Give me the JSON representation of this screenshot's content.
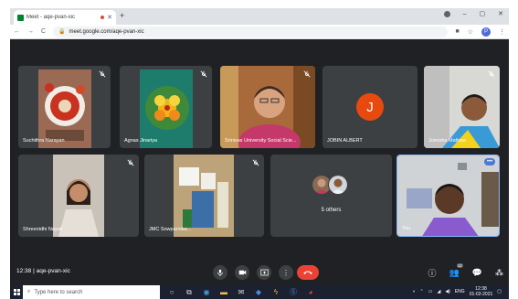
{
  "browser": {
    "tab_title": "Meet - aqe-pvan-xic",
    "tab_close": "✕",
    "new_tab": "+",
    "minimize": "–",
    "maximize": "▢",
    "close": "✕",
    "url": "meet.google.com/aqe-pvan-xic",
    "profile_initial": "P"
  },
  "participants": [
    {
      "name": "Suchithra Narayan",
      "muted": true
    },
    {
      "name": "Agnas Jinariya",
      "muted": true
    },
    {
      "name": "Srinivas University Social Scie...",
      "muted": true
    },
    {
      "name": "JOBIN ALBERT",
      "initial": "J",
      "muted": false
    },
    {
      "name": "Jomisha Mathew",
      "muted": true
    },
    {
      "name": "Shreenidhi Nayak",
      "muted": true
    },
    {
      "name": "JMC Sowparnika...",
      "muted": true
    },
    {
      "name": "5 others",
      "muted": false
    },
    {
      "name": "You",
      "muted": false
    }
  ],
  "meet_toolbar": {
    "time": "12:38",
    "meeting_code": "aqe-pvan-xic",
    "people_count": "12"
  },
  "taskbar": {
    "search_placeholder": "Type here to search",
    "tray_lang": "ENG",
    "clock_time": "12:38",
    "clock_date": "01-02-2021"
  },
  "colors": {
    "meet_bg": "#202124",
    "tile_bg": "#3c4043",
    "hangup": "#ea4335",
    "avatar_j": "#e8490f",
    "highlight": "#8ab4f8"
  }
}
